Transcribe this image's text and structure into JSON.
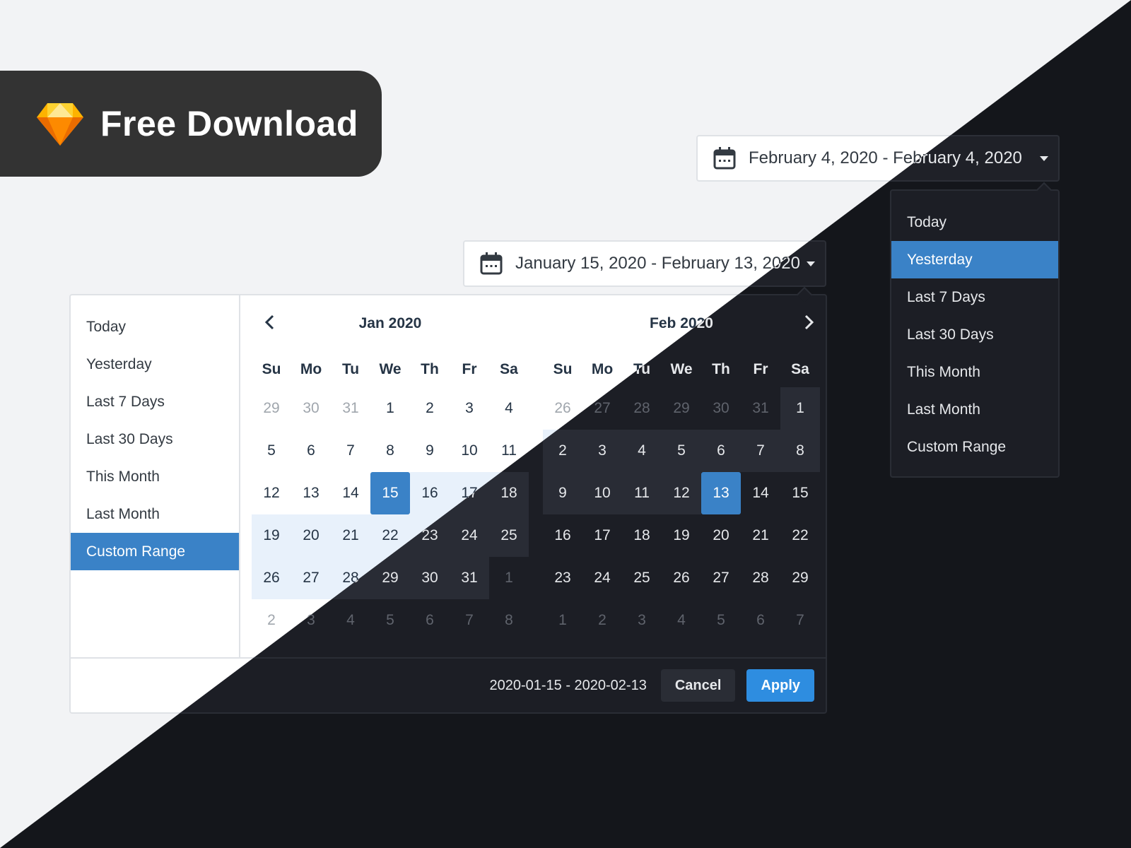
{
  "banner": {
    "text": "Free Download",
    "logo_icon": "sketch-diamond-icon"
  },
  "picker_a": {
    "input_text": "January 15, 2020 - February 13, 2020",
    "ranges": [
      "Today",
      "Yesterday",
      "Last 7 Days",
      "Last 30 Days",
      "This Month",
      "Last Month",
      "Custom Range"
    ],
    "active_range": "Custom Range",
    "weekdays": [
      "Su",
      "Mo",
      "Tu",
      "We",
      "Th",
      "Fr",
      "Sa"
    ],
    "months": [
      {
        "title": "Jan 2020",
        "weeks": [
          [
            "29",
            "30",
            "31",
            "1",
            "2",
            "3",
            "4"
          ],
          [
            "5",
            "6",
            "7",
            "8",
            "9",
            "10",
            "11"
          ],
          [
            "12",
            "13",
            "14",
            "15",
            "16",
            "17",
            "18"
          ],
          [
            "19",
            "20",
            "21",
            "22",
            "23",
            "24",
            "25"
          ],
          [
            "26",
            "27",
            "28",
            "29",
            "30",
            "31",
            "1"
          ],
          [
            "2",
            "3",
            "4",
            "5",
            "6",
            "7",
            "8"
          ]
        ]
      },
      {
        "title": "Feb 2020",
        "weeks": [
          [
            "26",
            "27",
            "28",
            "29",
            "30",
            "31",
            "1"
          ],
          [
            "2",
            "3",
            "4",
            "5",
            "6",
            "7",
            "8"
          ],
          [
            "9",
            "10",
            "11",
            "12",
            "13",
            "14",
            "15"
          ],
          [
            "16",
            "17",
            "18",
            "19",
            "20",
            "21",
            "22"
          ],
          [
            "23",
            "24",
            "25",
            "26",
            "27",
            "28",
            "29"
          ],
          [
            "1",
            "2",
            "3",
            "4",
            "5",
            "6",
            "7"
          ]
        ]
      }
    ],
    "range_start": "2020-01-15",
    "range_end": "2020-02-13",
    "summary": "2020-01-15 - 2020-02-13",
    "cancel_label": "Cancel",
    "apply_label": "Apply"
  },
  "picker_b": {
    "input_text": "February 4, 2020 - February 4, 2020",
    "ranges": [
      "Today",
      "Yesterday",
      "Last 7 Days",
      "Last 30 Days",
      "This Month",
      "Last Month",
      "Custom Range"
    ],
    "active_range": "Yesterday"
  },
  "colors": {
    "accent": "#3a82c7",
    "apply": "#2e8de0",
    "light_bg": "#f2f3f5",
    "dark_bg": "#14161b",
    "banner_bg": "#333333"
  }
}
